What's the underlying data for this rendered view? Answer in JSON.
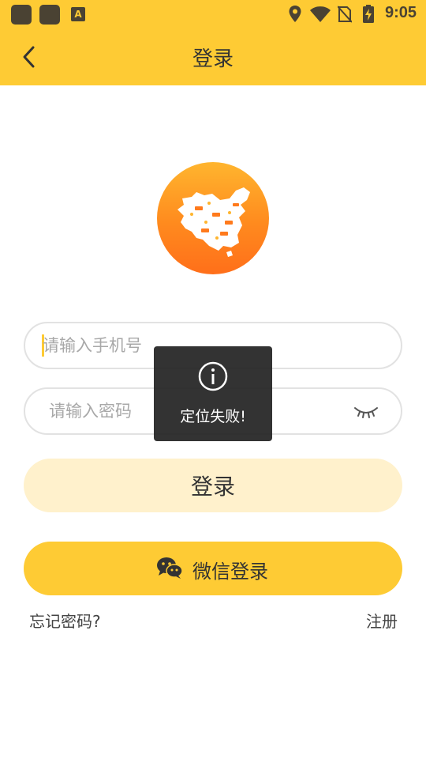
{
  "status_bar": {
    "time": "9:05",
    "left_badge": "A",
    "icons": [
      "app-icon",
      "app-icon",
      "accessibility-icon",
      "location-icon",
      "wifi-icon",
      "no-sim-icon",
      "battery-charging-icon"
    ]
  },
  "header": {
    "title": "登录",
    "back_icon": "chevron-left-icon"
  },
  "form": {
    "phone_placeholder": "请输入手机号",
    "password_placeholder": "请输入密码",
    "password_toggle_icon": "eye-closed-icon"
  },
  "actions": {
    "login_label": "登录",
    "wechat_label": "微信登录",
    "forgot_label": "忘记密码?",
    "register_label": "注册"
  },
  "toast": {
    "icon": "info-icon",
    "message": "定位失败!"
  },
  "colors": {
    "brand_yellow": "#FECB34",
    "login_button_bg": "#FFF1CC",
    "logo_orange": "#FF8A1E",
    "toast_bg": "#222222"
  }
}
